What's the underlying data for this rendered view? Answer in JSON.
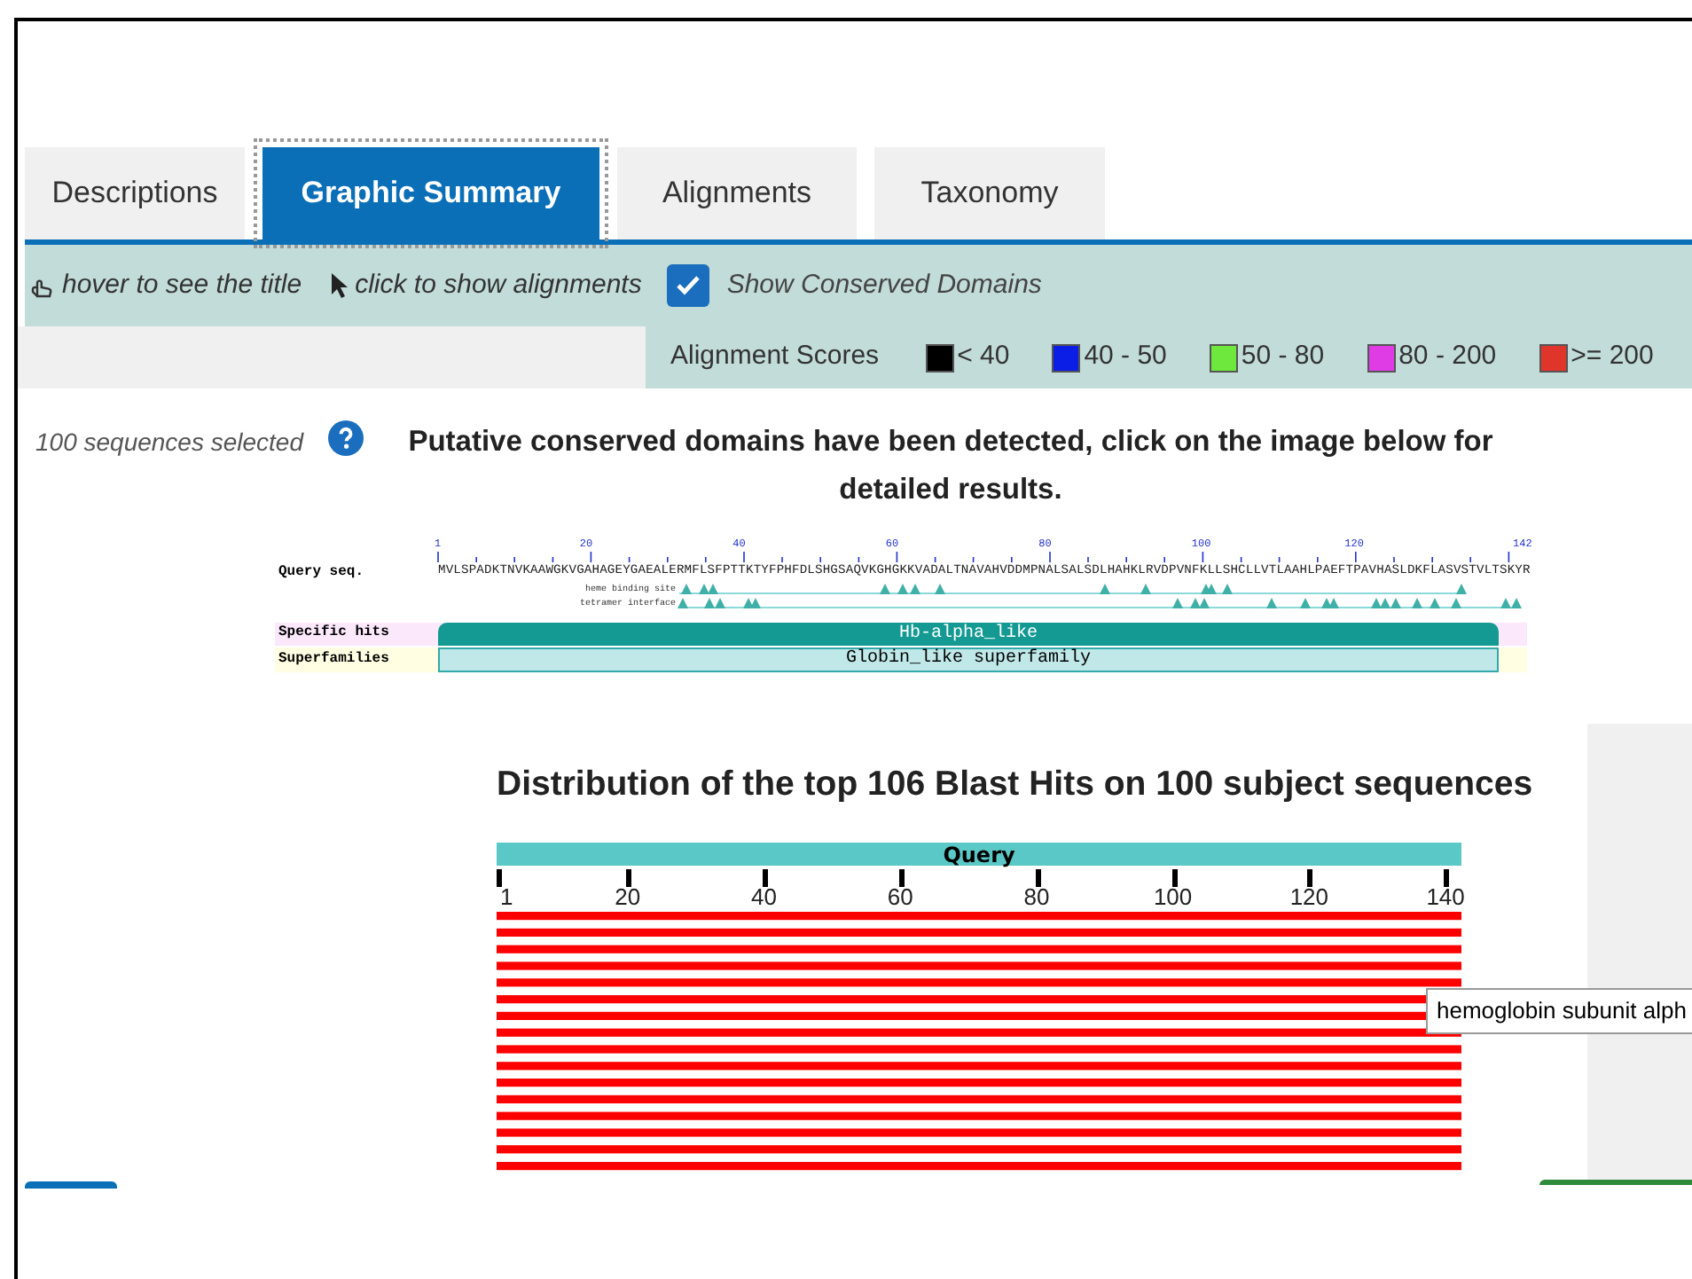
{
  "tabs": [
    {
      "label": "Descriptions",
      "selected": false
    },
    {
      "label": "Graphic Summary",
      "selected": true
    },
    {
      "label": "Alignments",
      "selected": false
    },
    {
      "label": "Taxonomy",
      "selected": false
    }
  ],
  "toolbar": {
    "hover_hint": "hover to see the title",
    "click_hint": "click to show alignments",
    "show_conserved_domains": {
      "label": "Show Conserved Domains",
      "checked": true
    }
  },
  "alignment_scores": {
    "title": "Alignment Scores",
    "items": [
      {
        "label": "< 40",
        "color": "#000000"
      },
      {
        "label": "40 - 50",
        "color": "#0a1ee6"
      },
      {
        "label": "50 - 80",
        "color": "#6ee83c"
      },
      {
        "label": "80 - 200",
        "color": "#e03ce6"
      },
      {
        "label": ">= 200",
        "color": "#e0352b"
      }
    ]
  },
  "selection_note": "100 sequences selected",
  "cdd_message": "Putative conserved domains have been detected, click on the image below for detailed results.",
  "conserved_domains": {
    "query_label": "Query seq.",
    "sequence": "MVLSPADKTNVKAAWGKVGAHAGEYGAEALERMFLSFPTTKTYFPHFDLSHGSAQVKGHGKKVADALTNAVAHVDDMPNALSALSDLHAHKLRVDPVNFKLLSHCLLVTLAAHLPAEFTPAVHASLDKFLASVSTVLTSKYR",
    "ruler": [
      "1",
      "20",
      "40",
      "60",
      "80",
      "100",
      "120",
      "142"
    ],
    "sites": [
      "heme binding site",
      "tetramer interface"
    ],
    "specific_label": "Specific hits",
    "specific_hit": "Hb-alpha_like",
    "superfamily_label": "Superfamilies",
    "superfamily": "Globin_like superfamily"
  },
  "distribution": {
    "title": "Distribution of the top 106 Blast Hits on 100 subject sequences",
    "query_label": "Query",
    "ticks": [
      "1",
      "20",
      "40",
      "60",
      "80",
      "100",
      "120",
      "140"
    ],
    "tooltip": "hemoglobin subunit alph"
  }
}
